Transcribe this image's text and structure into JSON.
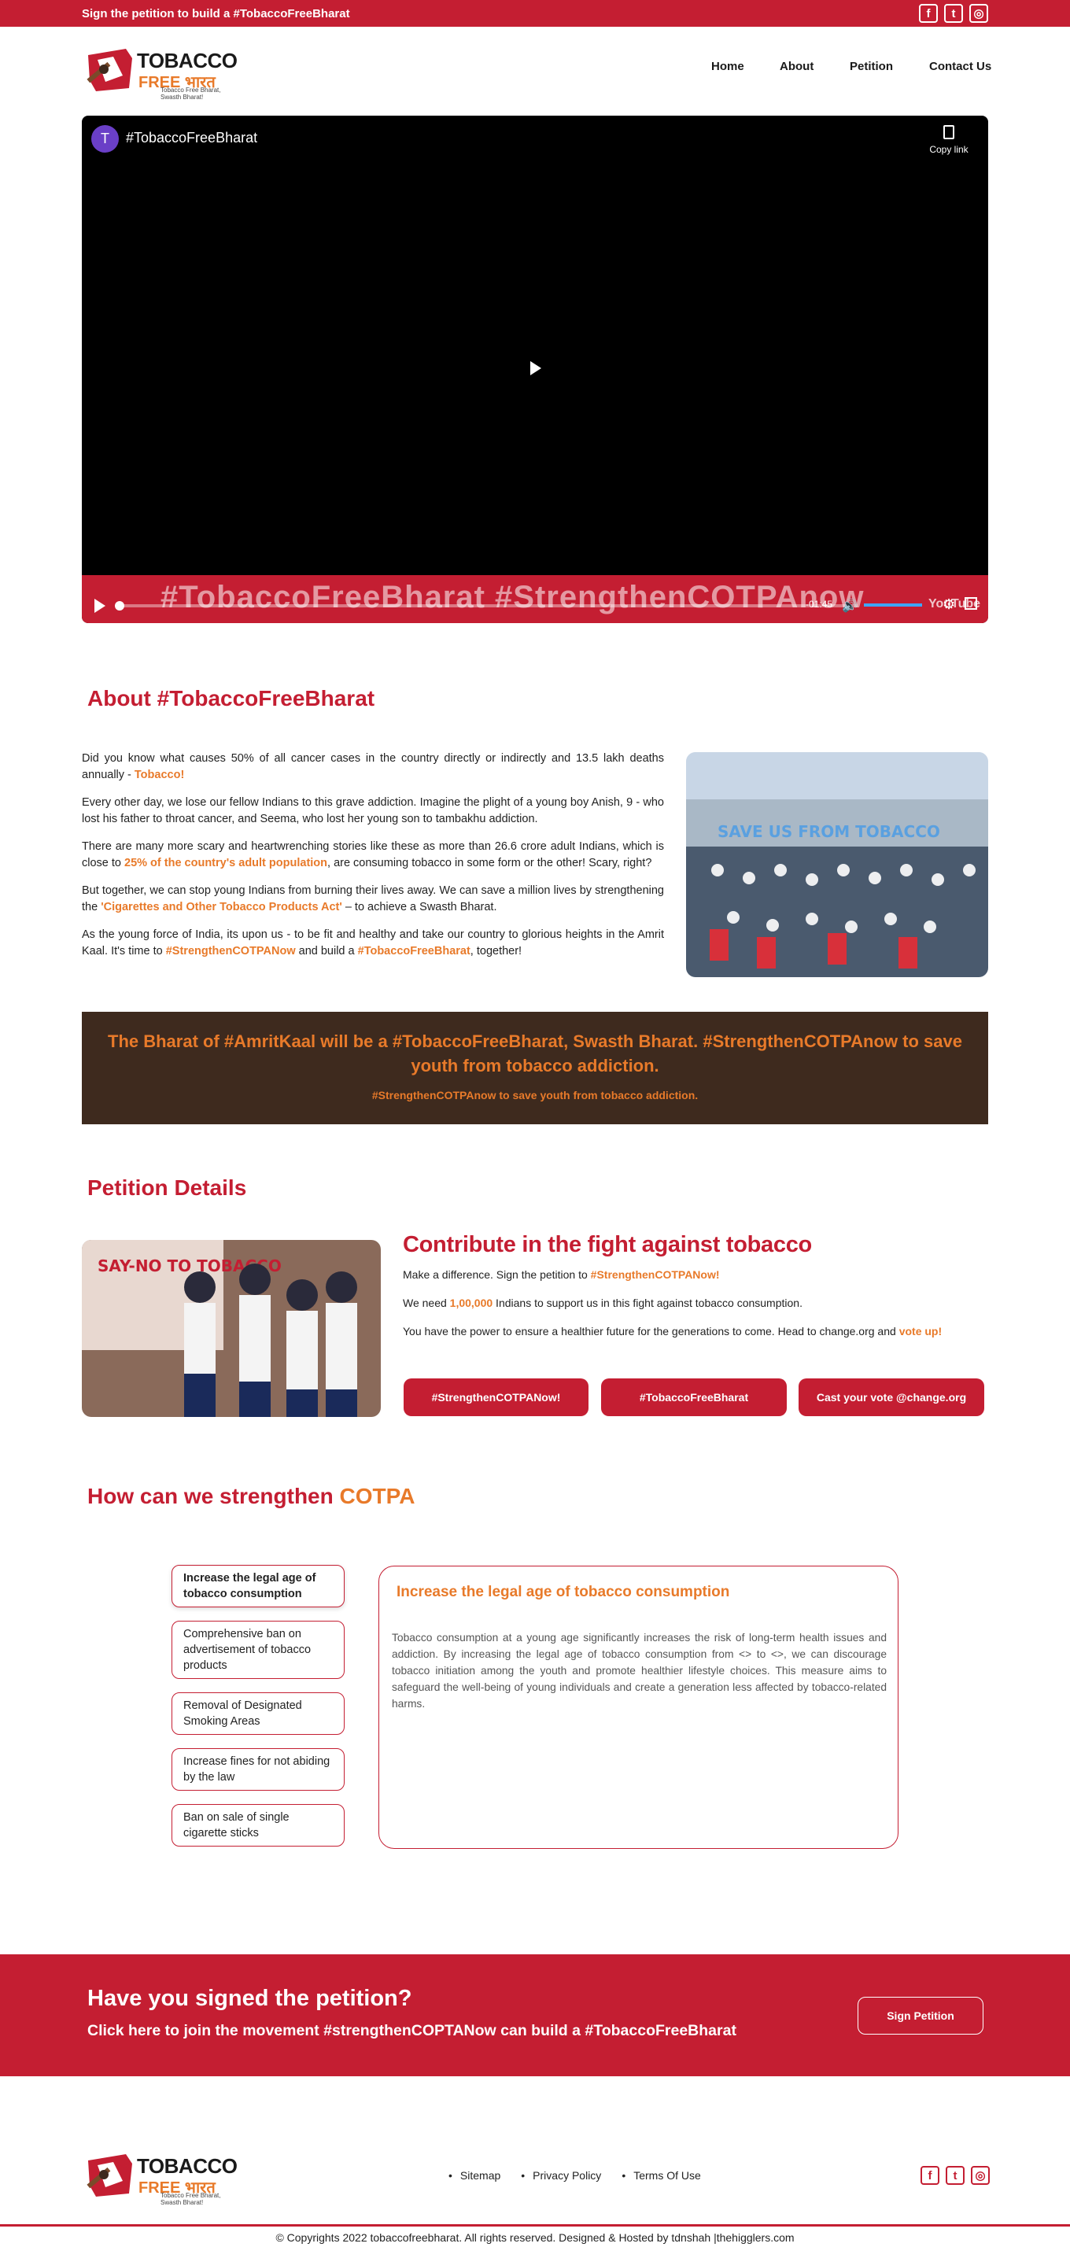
{
  "topbar": {
    "message": "Sign the petition to build a #TobaccoFreeBharat",
    "social": [
      "facebook-icon",
      "twitter-icon",
      "instagram-icon"
    ]
  },
  "logo": {
    "line1": "TOBACCO",
    "line2": "FREE भारत",
    "tagline": "Tobacco Free Bharat, Swasth Bharat!"
  },
  "nav": {
    "items": [
      "Home",
      "About",
      "Petition",
      "Contact Us"
    ]
  },
  "video": {
    "channel_initial": "T",
    "title": "#TobaccoFreeBharat",
    "copy_link": "Copy link",
    "banner_text": "#TobaccoFreeBharat #StrengthenCOTPAnow",
    "time": "-01:45",
    "youtube": "YouTube"
  },
  "about": {
    "heading": "About #TobaccoFreeBharat",
    "p1": "Did you know what causes 50% of all cancer cases in the country directly or indirectly and 13.5 lakh deaths annually - ",
    "p1_hl": "Tobacco!",
    "p2": "Every other day, we lose our fellow Indians to this grave addiction. Imagine the plight of a young boy Anish, 9 - who lost his father to throat cancer, and Seema, who lost her young son to tambakhu addiction.",
    "p3a": "There are many more scary and heartwrenching stories like these as more than 26.6 crore adult Indians, which is close to ",
    "p3_hl": "25% of the country's adult population",
    "p3b": ", are consuming tobacco in some form or the other! Scary, right?",
    "p4a": "But together, we can stop young Indians from burning their lives away. We can save a million lives by strengthening the ",
    "p4_hl": "'Cigarettes and Other Tobacco Products Act'",
    "p4b": " – to achieve a Swasth Bharat.",
    "p5a": "As the young force of India, its upon us - to be fit and healthy and take our country to glorious heights in the Amrit Kaal. It's time to ",
    "p5_hl1": "#StrengthenCOTPANow",
    "p5b": " and build a ",
    "p5_hl2": "#TobaccoFreeBharat",
    "p5c": ", together!",
    "photo_text": "SAVE US FROM TOBACCO"
  },
  "band": {
    "headline": "The Bharat of #AmritKaal will be a #TobaccoFreeBharat, Swasth Bharat. #StrengthenCOTPAnow to save youth from tobacco addiction.",
    "sub": "#StrengthenCOTPAnow to save youth from tobacco addiction."
  },
  "petition": {
    "heading": "Petition Details",
    "photo_text": "SAY-NO TO TOBACCO",
    "title": "Contribute in the fight against tobacco",
    "l1a": "Make a difference. Sign the petition to ",
    "l1_hl": "#StrengthenCOTPANow!",
    "l2a": "We need ",
    "l2_hl": "1,00,000",
    "l2b": " Indians to support us in this fight against tobacco consumption.",
    "l3a": "You have the power to ensure a healthier future for the generations to come. Head to change.org and ",
    "l3_hl": "vote up!",
    "buttons": [
      "#StrengthenCOTPANow!",
      "#TobaccoFreeBharat",
      "Cast your vote @change.org"
    ]
  },
  "cotpa": {
    "heading_a": "How can we strengthen ",
    "heading_b": "COTPA",
    "tabs": [
      "Increase the legal age of tobacco consumption",
      "Comprehensive ban on advertisement of tobacco products",
      "Removal of Designated Smoking Areas",
      "Increase fines for not abiding by the law",
      "Ban on sale of single cigarette sticks"
    ],
    "panel_title": "Increase the legal age of tobacco consumption",
    "panel_text": "Tobacco consumption at a young age significantly increases the risk of long-term health issues and addiction. By increasing the legal age of tobacco consumption from <> to <>, we can discourage tobacco initiation among the youth and promote healthier lifestyle choices. This measure aims to safeguard the well-being of young individuals and create a generation less affected by tobacco-related harms."
  },
  "cta": {
    "title": "Have you signed the petition?",
    "sub": "Click here to join the movement #strengthenCOPTANow can build a #TobaccoFreeBharat",
    "button": "Sign Petition"
  },
  "footer": {
    "links": [
      "Sitemap",
      "Privacy Policy",
      "Terms Of Use"
    ],
    "copyright": "© Copyrights 2022 tobaccofreebharat. All rights reserved. Designed & Hosted by tdnshah |thehigglers.com"
  },
  "colors": {
    "brand_red": "#c41e32",
    "accent_orange": "#e87a2a",
    "band_brown": "#3e2a1e"
  }
}
